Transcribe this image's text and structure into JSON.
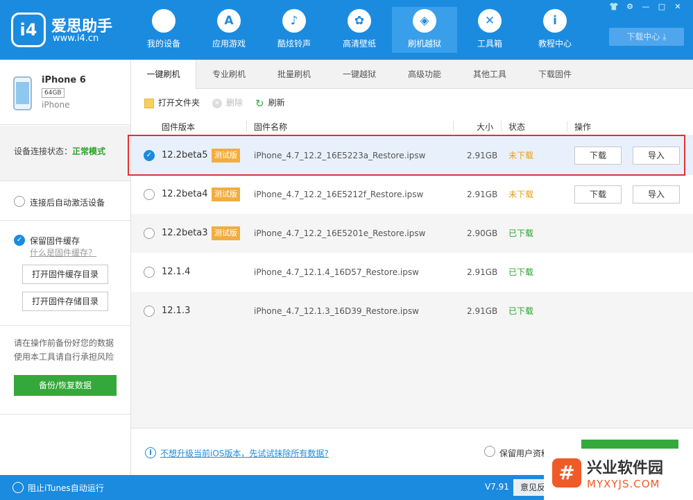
{
  "app": {
    "logo_mark": "i4",
    "name": "爱思助手",
    "url": "www.i4.cn",
    "download_center": "下载中心"
  },
  "window_controls": [
    {
      "name": "skin-icon",
      "glyph": "👕"
    },
    {
      "name": "gear-icon",
      "glyph": "⚙"
    },
    {
      "name": "minimize-icon",
      "glyph": "—"
    },
    {
      "name": "maximize-icon",
      "glyph": "□"
    },
    {
      "name": "close-icon",
      "glyph": "✕"
    }
  ],
  "nav": [
    {
      "id": "my-device",
      "label": "我的设备",
      "icon": "apple-icon",
      "glyph": ""
    },
    {
      "id": "apps",
      "label": "应用游戏",
      "icon": "app-store-icon",
      "glyph": "A"
    },
    {
      "id": "ringtones",
      "label": "酷炫铃声",
      "icon": "bell-icon",
      "glyph": "♪"
    },
    {
      "id": "wallpapers",
      "label": "高清壁纸",
      "icon": "flower-icon",
      "glyph": "✿"
    },
    {
      "id": "flash",
      "label": "刷机越狱",
      "icon": "dropbox-icon",
      "glyph": "◈",
      "active": true
    },
    {
      "id": "toolbox",
      "label": "工具箱",
      "icon": "tools-icon",
      "glyph": "✕"
    },
    {
      "id": "tutorials",
      "label": "教程中心",
      "icon": "info-icon",
      "glyph": "i"
    }
  ],
  "device": {
    "name": "iPhone 6",
    "capacity": "64GB",
    "type": "iPhone"
  },
  "sidebar": {
    "conn_label": "设备连接状态：",
    "conn_value": "正常模式",
    "auto_activate": "连接后自动激活设备",
    "keep_cache": "保留固件缓存",
    "cache_link": "什么是固件缓存？",
    "open_cache_dir": "打开固件缓存目录",
    "open_store_dir": "打开固件存储目录",
    "warn_line1": "请在操作前备份好您的数据",
    "warn_line2": "使用本工具请自行承担风险",
    "backup_button": "备份/恢复数据"
  },
  "tabs": [
    "一键刷机",
    "专业刷机",
    "批量刷机",
    "一键越狱",
    "高级功能",
    "其他工具",
    "下载固件"
  ],
  "toolbar": {
    "open_folder": "打开文件夹",
    "delete": "删除",
    "refresh": "刷新"
  },
  "columns": {
    "version": "固件版本",
    "name": "固件名称",
    "size": "大小",
    "status": "状态",
    "action": "操作"
  },
  "firmware": [
    {
      "version": "12.2beta5",
      "badge": "测试版",
      "name": "iPhone_4.7_12.2_16E5223a_Restore.ipsw",
      "size": "2.91GB",
      "status": "未下载",
      "downloaded": false,
      "selected": true,
      "btn_download": "下载",
      "btn_import": "导入"
    },
    {
      "version": "12.2beta4",
      "badge": "测试版",
      "name": "iPhone_4.7_12.2_16E5212f_Restore.ipsw",
      "size": "2.91GB",
      "status": "未下载",
      "downloaded": false,
      "selected": false,
      "btn_download": "下载",
      "btn_import": "导入"
    },
    {
      "version": "12.2beta3",
      "badge": "测试版",
      "name": "iPhone_4.7_12.2_16E5201e_Restore.ipsw",
      "size": "2.90GB",
      "status": "已下载",
      "downloaded": true,
      "selected": false
    },
    {
      "version": "12.1.4",
      "badge": "",
      "name": "iPhone_4.7_12.1.4_16D57_Restore.ipsw",
      "size": "2.91GB",
      "status": "已下载",
      "downloaded": true,
      "selected": false
    },
    {
      "version": "12.1.3",
      "badge": "",
      "name": "iPhone_4.7_12.1.3_16D39_Restore.ipsw",
      "size": "2.91GB",
      "status": "已下载",
      "downloaded": true,
      "selected": false
    }
  ],
  "bottom": {
    "info_link": "不想升级当前iOS版本，先试试抹除所有数据?",
    "keep_user_data": "保留用户资料"
  },
  "statusbar": {
    "block_itunes": "阻止iTunes自动运行",
    "version": "V7.91",
    "feedback": "意见反馈"
  },
  "watermark": {
    "title": "兴业软件园",
    "sub": "MYXYJS.COM"
  },
  "colors": {
    "primary": "#1b8be0",
    "green": "#35a83b",
    "orange": "#f3ad3e",
    "highlight": "#e03131"
  }
}
